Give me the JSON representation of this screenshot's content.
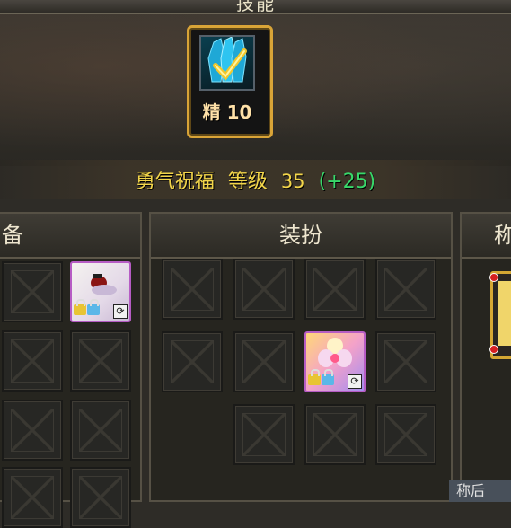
{
  "top_title": "技能",
  "skill": {
    "grade": "精",
    "level": "10"
  },
  "blessing": {
    "name": "勇气祝福",
    "level_label": "等级",
    "level_value": "35",
    "bonus": "(+25)"
  },
  "panels": {
    "left": {
      "title": "备"
    },
    "middle": {
      "title": "装扮"
    },
    "right": {
      "title": "称"
    }
  },
  "bottom_fragment": "称后"
}
